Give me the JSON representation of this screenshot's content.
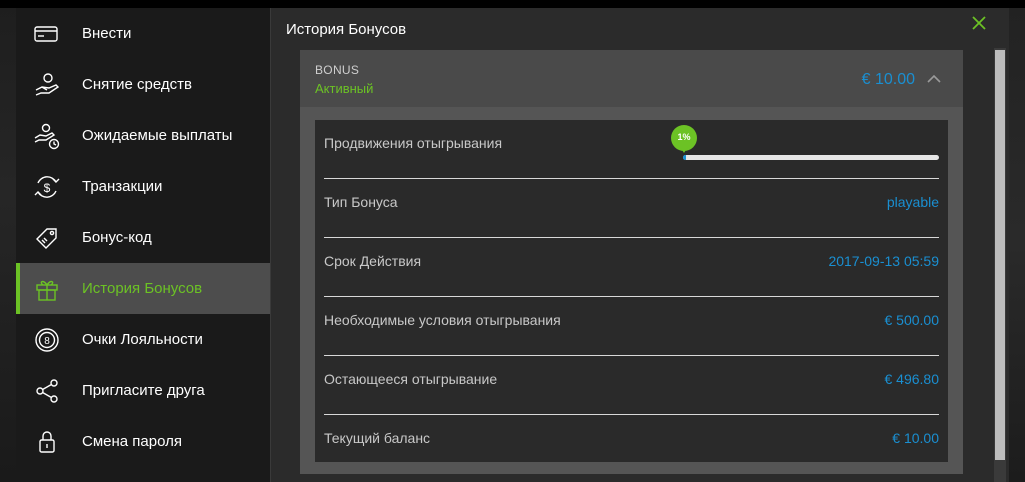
{
  "colors": {
    "accent": "#6cc225",
    "link": "#1a8fd1",
    "sidebar": "#1a1a1a",
    "panel": "#2b2b2b"
  },
  "sidebar": {
    "items": [
      {
        "label": "Внести",
        "icon": "credit-card-icon"
      },
      {
        "label": "Снятие средств",
        "icon": "hand-money-icon"
      },
      {
        "label": "Ожидаемые выплаты",
        "icon": "pending-payout-icon"
      },
      {
        "label": "Транзакции",
        "icon": "dollar-refresh-icon"
      },
      {
        "label": "Бонус-код",
        "icon": "tag-icon"
      },
      {
        "label": "История Бонусов",
        "icon": "gift-icon",
        "active": true
      },
      {
        "label": "Очки Лояльности",
        "icon": "loyalty-badge-icon"
      },
      {
        "label": "Пригласите друга",
        "icon": "share-icon"
      },
      {
        "label": "Смена пароля",
        "icon": "lock-icon"
      }
    ]
  },
  "main": {
    "title": "История Бонусов",
    "bonus": {
      "type": "BONUS",
      "status": "Активный",
      "amount": "€ 10.00",
      "progress": {
        "label": "Продвижения отыгрывания",
        "value_text": "1%",
        "fraction": 0.01
      },
      "rows": [
        {
          "key": "Тип Бонуса",
          "value": "playable"
        },
        {
          "key": "Срок Действия",
          "value": "2017-09-13 05:59"
        },
        {
          "key": "Необходимые условия отыгрывания",
          "value": "€ 500.00"
        },
        {
          "key": "Остающееся отыгрывание",
          "value": "€ 496.80"
        },
        {
          "key": "Текущий баланс",
          "value": "€ 10.00"
        }
      ]
    }
  }
}
